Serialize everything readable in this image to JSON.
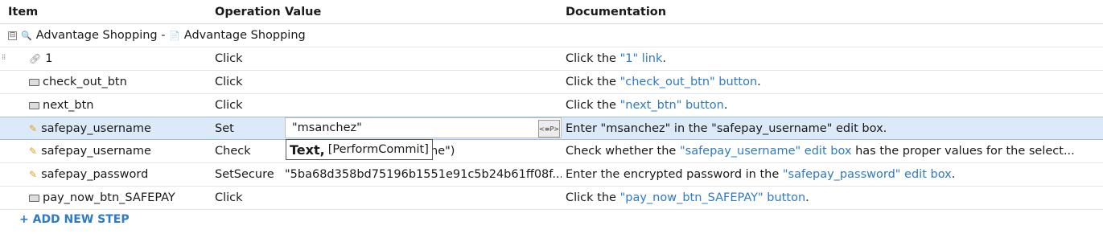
{
  "headers": {
    "item": "Item",
    "operation": "Operation",
    "value": "Value",
    "documentation": "Documentation"
  },
  "group": {
    "expander": "⊟",
    "test_name": "Advantage Shopping",
    "separator": " - ",
    "page_name": "Advantage Shopping"
  },
  "rows": [
    {
      "icon": "link-icon",
      "item": "1",
      "operation": "Click",
      "value": "",
      "doc_pre": "Click the ",
      "doc_link": "\"1\" link",
      "doc_post": "."
    },
    {
      "icon": "button-icon",
      "item": "check_out_btn",
      "operation": "Click",
      "value": "",
      "doc_pre": "Click the ",
      "doc_link": "\"check_out_btn\" button",
      "doc_post": "."
    },
    {
      "icon": "button-icon",
      "item": "next_btn",
      "operation": "Click",
      "value": "",
      "doc_pre": "Click the ",
      "doc_link": "\"next_btn\" button",
      "doc_post": "."
    },
    {
      "icon": "edit-icon",
      "item": "safepay_username",
      "operation": "Set",
      "value": "\"msanchez\"",
      "doc_pre": "Enter \"msanchez\" in the \"safepay_username\" edit box.",
      "doc_link": "",
      "doc_post": ""
    },
    {
      "icon": "edit-icon",
      "item": "safepay_username",
      "operation": "Check",
      "value": "name\")",
      "doc_pre": "Check whether the ",
      "doc_link": "\"safepay_username\" edit box",
      "doc_post": " has the proper values for the select..."
    },
    {
      "icon": "edit-icon",
      "item": "safepay_password",
      "operation": "SetSecure",
      "value": "\"5ba68d358bd75196b1551e91c5b24b61ff08f...",
      "doc_pre": "Enter the encrypted password in the ",
      "doc_link": "\"safepay_password\" edit box",
      "doc_post": "."
    },
    {
      "icon": "button-icon",
      "item": "pay_now_btn_SAFEPAY",
      "operation": "Click",
      "value": "",
      "doc_pre": "Click the ",
      "doc_link": "\"pay_now_btn_SAFEPAY\" button",
      "doc_post": "."
    }
  ],
  "editor": {
    "value": "\"msanchez\"",
    "param_button": "<≡P>"
  },
  "tooltip": {
    "bold": "Text,",
    "rest": "[PerformCommit]"
  },
  "add_step": "+ ADD NEW STEP",
  "colors": {
    "link": "#2d7ac5",
    "selected_row": "#dbe9f8"
  }
}
